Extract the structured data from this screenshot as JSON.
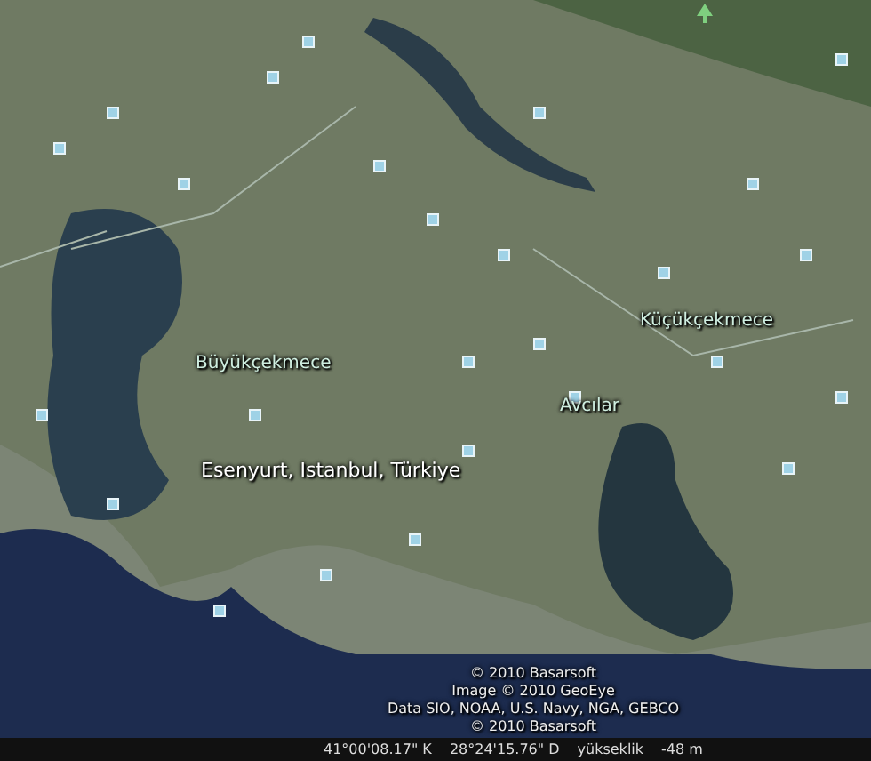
{
  "map": {
    "places": [
      {
        "kind": "district",
        "label": "Büyükçekmece"
      },
      {
        "kind": "district",
        "label": "Küçükçekmece"
      },
      {
        "kind": "district",
        "label": "Avcılar"
      },
      {
        "kind": "search",
        "label": "Esenyurt, Istanbul, Türkiye"
      }
    ],
    "copyright": [
      "© 2010 Basarsoft",
      "Image © 2010 GeoEye",
      "Data SIO, NOAA, U.S. Navy, NGA, GEBCO",
      "© 2010 Basarsoft"
    ]
  },
  "status_bar": {
    "latitude": "41°00'08.17\" K",
    "longitude": "28°24'15.76\" D",
    "elevation_label": "yükseklik",
    "elevation": "-48 m"
  }
}
